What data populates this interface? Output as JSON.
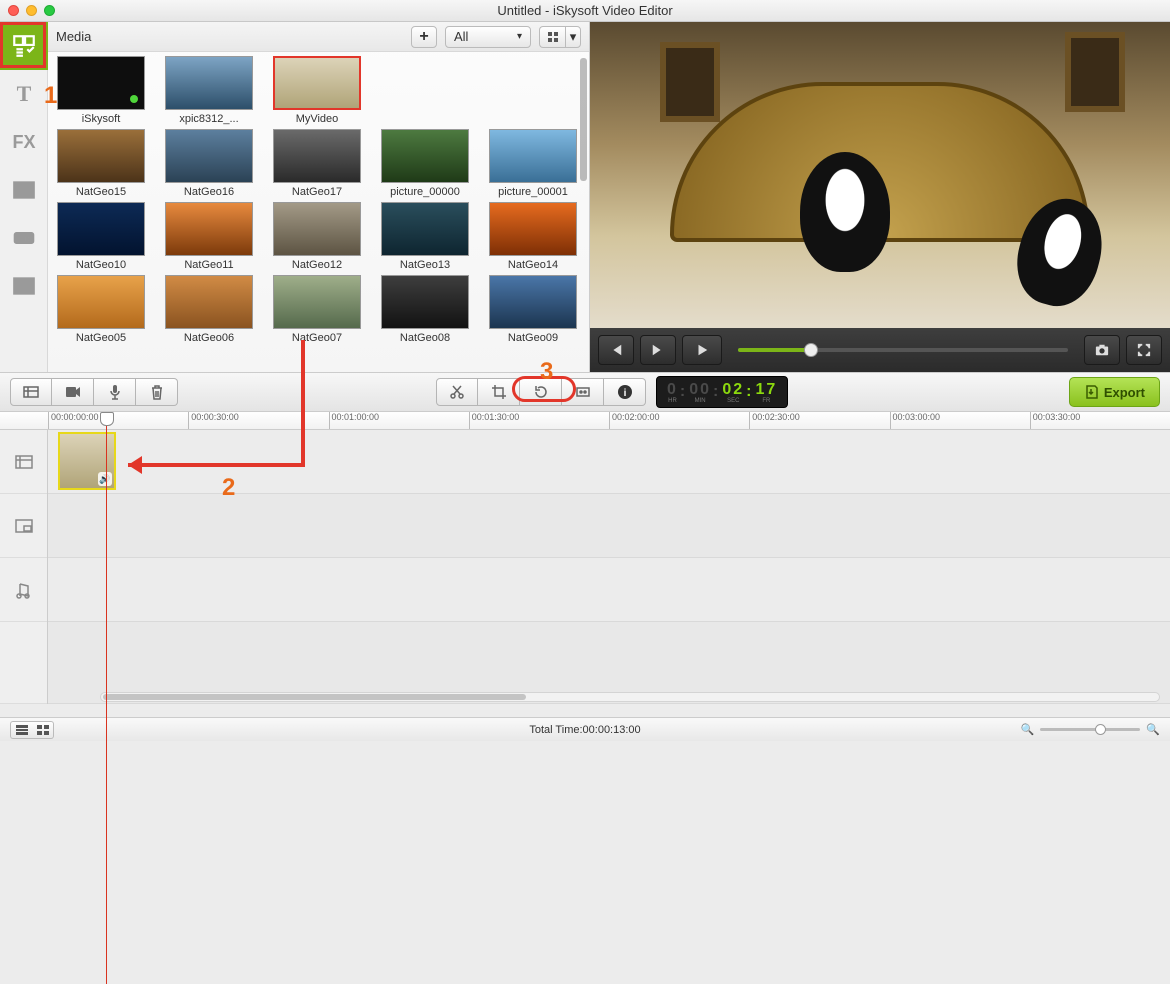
{
  "window_title": "Untitled - iSkysoft Video Editor",
  "sidebar_tools": [
    "media",
    "text",
    "fx",
    "pip",
    "intertitle",
    "split"
  ],
  "media_header": {
    "label": "Media",
    "filter": "All"
  },
  "media_items": [
    [
      {
        "name": "NatGeo05",
        "g": "g1"
      },
      {
        "name": "NatGeo06",
        "g": "g2"
      },
      {
        "name": "NatGeo07",
        "g": "g3"
      },
      {
        "name": "NatGeo08",
        "g": "g4"
      },
      {
        "name": "NatGeo09",
        "g": "g5"
      }
    ],
    [
      {
        "name": "NatGeo10",
        "g": "g6"
      },
      {
        "name": "NatGeo11",
        "g": "g7"
      },
      {
        "name": "NatGeo12",
        "g": "g8"
      },
      {
        "name": "NatGeo13",
        "g": "g9"
      },
      {
        "name": "NatGeo14",
        "g": "g10"
      }
    ],
    [
      {
        "name": "NatGeo15",
        "g": "g11"
      },
      {
        "name": "NatGeo16",
        "g": "g12"
      },
      {
        "name": "NatGeo17",
        "g": "g13"
      },
      {
        "name": "picture_00000",
        "g": "g14"
      },
      {
        "name": "picture_00001",
        "g": "g15"
      }
    ],
    [
      {
        "name": "iSkysoft",
        "g": "g17",
        "dot": true
      },
      {
        "name": "xpic8312_...",
        "g": "g16"
      },
      {
        "name": "MyVideo",
        "g": "g18",
        "selected": true
      }
    ]
  ],
  "timecode": {
    "hr": "0",
    "min": "00",
    "sec": "02",
    "fr": "17",
    "hr_label": "HR",
    "min_label": "MIN",
    "sec_label": "SEC",
    "fr_label": "FR",
    "display_dark": "0:00:"
  },
  "export_label": "Export",
  "ruler_ticks": [
    "00:00:00:00",
    "00:00:30:00",
    "00:01:00:00",
    "00:01:30:00",
    "00:02:00:00",
    "00:02:30:00",
    "00:03:00:00",
    "00:03:30:00"
  ],
  "status_total": "Total Time:00:00:13:00",
  "annotations": {
    "n1": "1",
    "n2": "2",
    "n3": "3"
  }
}
